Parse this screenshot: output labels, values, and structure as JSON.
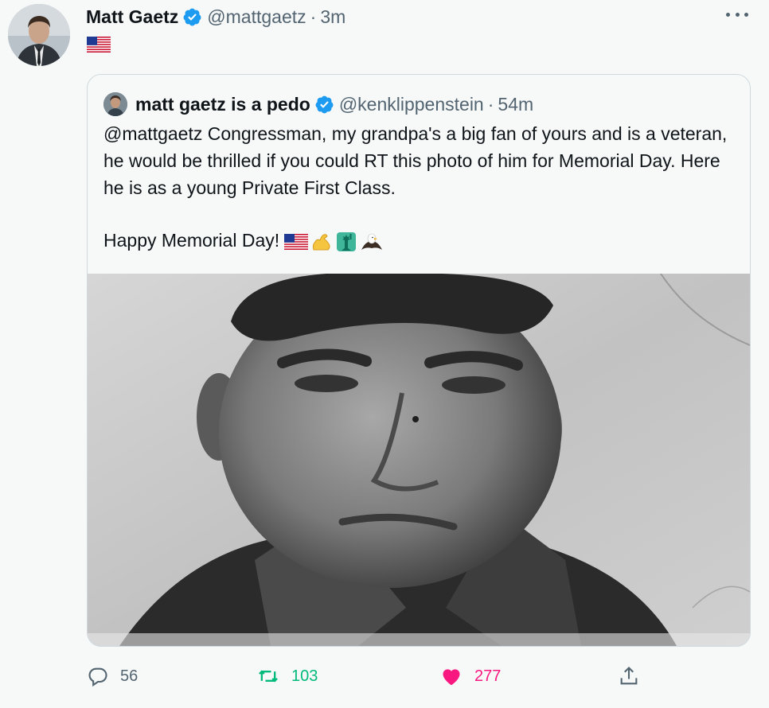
{
  "author": {
    "display_name": "Matt Gaetz",
    "handle": "@mattgaetz",
    "separator": "·",
    "timestamp": "3m",
    "flag_icon": "us-flag-icon"
  },
  "quoted": {
    "display_name": "matt gaetz is a pedo",
    "handle": "@kenklippenstein",
    "separator": "·",
    "timestamp": "54m",
    "text_line1": "@mattgaetz Congressman, my grandpa's a big fan of yours and is a veteran, he would be thrilled if you could RT this photo of him for Memorial Day. Here he is as a young Private First Class.",
    "text_line2": "Happy Memorial Day!",
    "emojis": [
      "us-flag-icon",
      "flexed-biceps-icon",
      "statue-of-liberty-icon",
      "eagle-icon"
    ]
  },
  "actions": {
    "reply_count": "56",
    "retweet_count": "103",
    "like_count": "277"
  },
  "colors": {
    "verified": "#1d9bf0",
    "secondary_text": "#536471",
    "retweet": "#00ba7c",
    "like": "#f91880",
    "background": "#f7f9f9"
  }
}
